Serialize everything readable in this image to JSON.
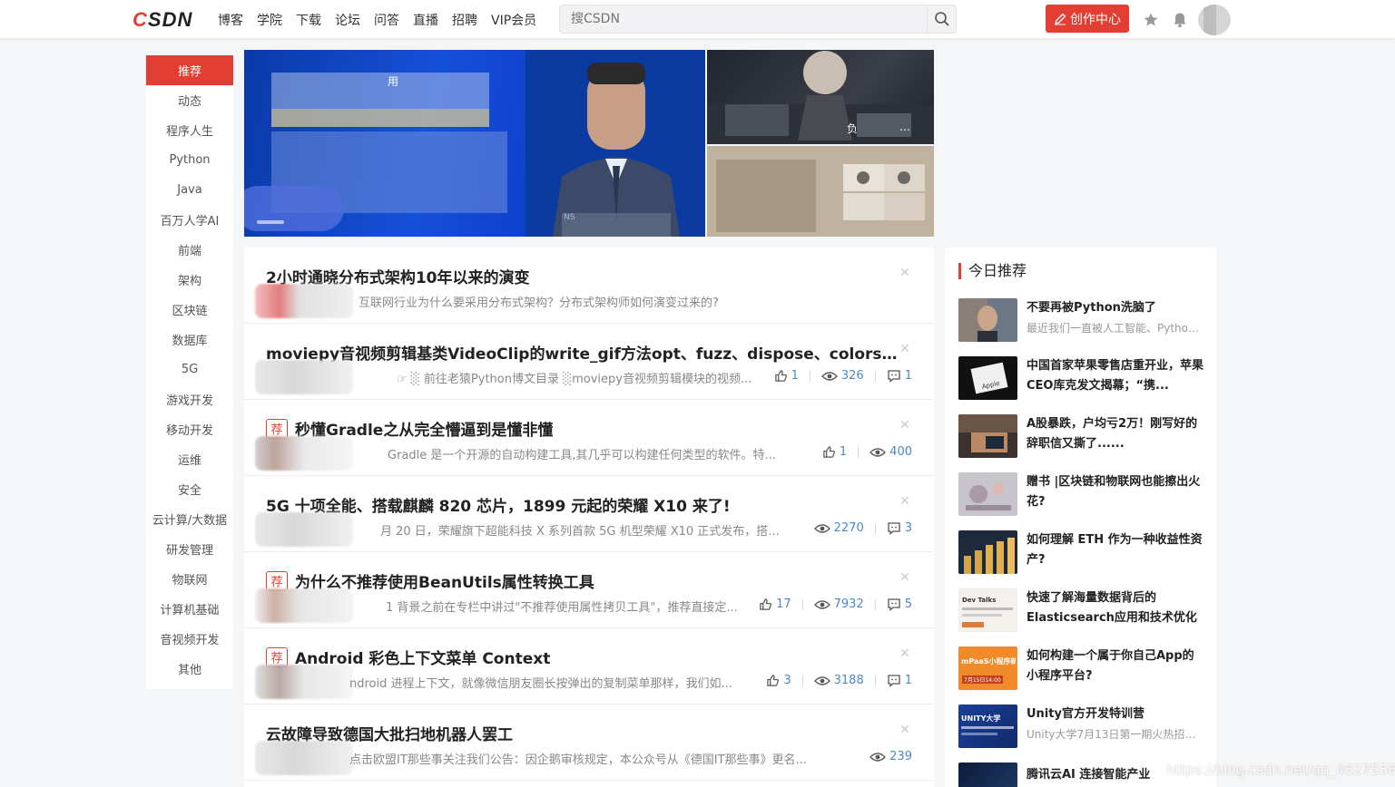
{
  "brand": {
    "logo": "CSDN"
  },
  "nav": [
    "博客",
    "学院",
    "下载",
    "论坛",
    "问答",
    "直播",
    "招聘",
    "VIP会员"
  ],
  "search": {
    "placeholder": "搜CSDN"
  },
  "create_button": "创作中心",
  "sidebar": [
    "推荐",
    "动态",
    "程序人生",
    "Python",
    "Java",
    "百万人学AI",
    "前端",
    "架构",
    "区块链",
    "数据库",
    "5G",
    "游戏开发",
    "移动开发",
    "运维",
    "安全",
    "云计算/大数据",
    "研发管理",
    "物联网",
    "计算机基础",
    "音视频开发",
    "其他"
  ],
  "banner": {
    "main_caption": "用",
    "side1_caption": "负",
    "side1_caption2": "…",
    "main_small": "NS"
  },
  "feed": [
    {
      "title": "2小时通晓分布式架构10年以来的演变",
      "tag": "",
      "desc": "互联网行业为什么要采用分布式架构？分布式架构师如何演变过来的?",
      "likes": "",
      "views": "",
      "comments": ""
    },
    {
      "title": "moviepy音视频剪辑基类VideoClip的write_gif方法opt、fuzz、dispose、colors、l...",
      "tag": "",
      "desc": "☞ ░ 前往老猿Python博文目录 ░moviepy音视频剪辑模块的视频...",
      "likes": "1",
      "views": "326",
      "comments": "1"
    },
    {
      "title": "秒懂Gradle之从完全懵逼到是懂非懂",
      "tag": "荐",
      "desc": "Gradle 是一个开源的自动构建工具,其几乎可以构建任何类型的软件。特...",
      "likes": "1",
      "views": "400",
      "comments": ""
    },
    {
      "title": "5G 十项全能、搭载麒麟 820 芯片，1899 元起的荣耀 X10 来了!",
      "tag": "",
      "desc": "月 20 日，荣耀旗下超能科技 X 系列首款 5G 机型荣耀 X10 正式发布，搭...",
      "likes": "",
      "views": "2270",
      "comments": "3"
    },
    {
      "title": "为什么不推荐使用BeanUtils属性转换工具",
      "tag": "荐",
      "desc": "1 背景之前在专栏中讲过\"不推荐使用属性拷贝工具\"，推荐直接定...",
      "likes": "17",
      "views": "7932",
      "comments": "5"
    },
    {
      "title": "Android 彩色上下文菜单 Context",
      "tag": "荐",
      "desc": "ndroid 进程上下文，就像微信朋友圈长按弹出的复制菜单那样，我们如...",
      "likes": "3",
      "views": "3188",
      "comments": "1"
    },
    {
      "title": "云故障导致德国大批扫地机器人罢工",
      "tag": "",
      "desc": "点击欧盟IT那些事关注我们公告：因企鹅审核规定，本公众号从《德国IT那些事》更名...",
      "likes": "",
      "views": "239",
      "comments": ""
    }
  ],
  "today": {
    "heading": "今日推荐",
    "items": [
      {
        "title": "不要再被Python洗脑了",
        "sub": "最近我们一直被人工智能、Python..."
      },
      {
        "title": "中国首家苹果零售店重开业，苹果CEO库克发文揭幕；“携...",
        "sub": ""
      },
      {
        "title": "A股暴跌，户均亏2万！刚写好的辞职信又撕了......",
        "sub": ""
      },
      {
        "title": "赠书 |区块链和物联网也能擦出火花?",
        "sub": ""
      },
      {
        "title": "如何理解 ETH 作为一种收益性资产?",
        "sub": ""
      },
      {
        "title": "快速了解海量数据背后的Elasticsearch应用和技术优化",
        "sub": ""
      },
      {
        "title": "如何构建一个属于你自己App的小程序平台?",
        "sub": ""
      },
      {
        "title": "Unity官方开发特训营",
        "sub": "Unity大学7月13日第一期火热招募..."
      },
      {
        "title": "腾讯云AI 连接智能产业",
        "sub": ""
      }
    ],
    "thumb_texts": {
      "apple": "Apple",
      "devtalks": "Dev Talks",
      "mpaas": "mPaaS小程序新品发布",
      "mpaas_date": "7月15日14:00",
      "unity": "UNITY大学"
    }
  },
  "watermark": "https://blog.csdn.net/qq_46275568",
  "colors": {
    "accent": "#e33e33",
    "link": "#4d88c7"
  }
}
